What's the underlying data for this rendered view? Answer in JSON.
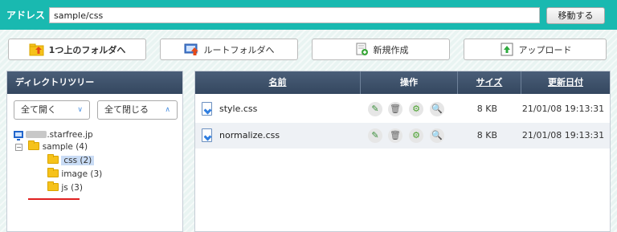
{
  "address": {
    "label": "アドレス",
    "value": "sample/css",
    "move_button": "移動する"
  },
  "toolbar": {
    "up_folder": "1つ上のフォルダへ",
    "root_folder": "ルートフォルダへ",
    "new_create": "新規作成",
    "upload": "アップロード"
  },
  "tree_panel": {
    "title": "ディレクトリツリー",
    "expand_all": "全て開く",
    "collapse_all": "全て閉じる",
    "nodes": {
      "root": ".starfree.jp",
      "sample": "sample (4)",
      "css": "css (2)",
      "image": "image (3)",
      "js": "js (3)"
    }
  },
  "file_table": {
    "headers": {
      "name": "名前",
      "ops": "操作",
      "size": "サイズ",
      "date": "更新日付"
    },
    "rows": [
      {
        "name": "style.css",
        "size": "8 KB",
        "date": "21/01/08 19:13:31"
      },
      {
        "name": "normalize.css",
        "size": "8 KB",
        "date": "21/01/08 19:13:31"
      }
    ]
  },
  "colors": {
    "accent": "#19b9b0",
    "header": "#3d5068",
    "folder": "#f6c21a",
    "selection_underline": "#e02020"
  }
}
